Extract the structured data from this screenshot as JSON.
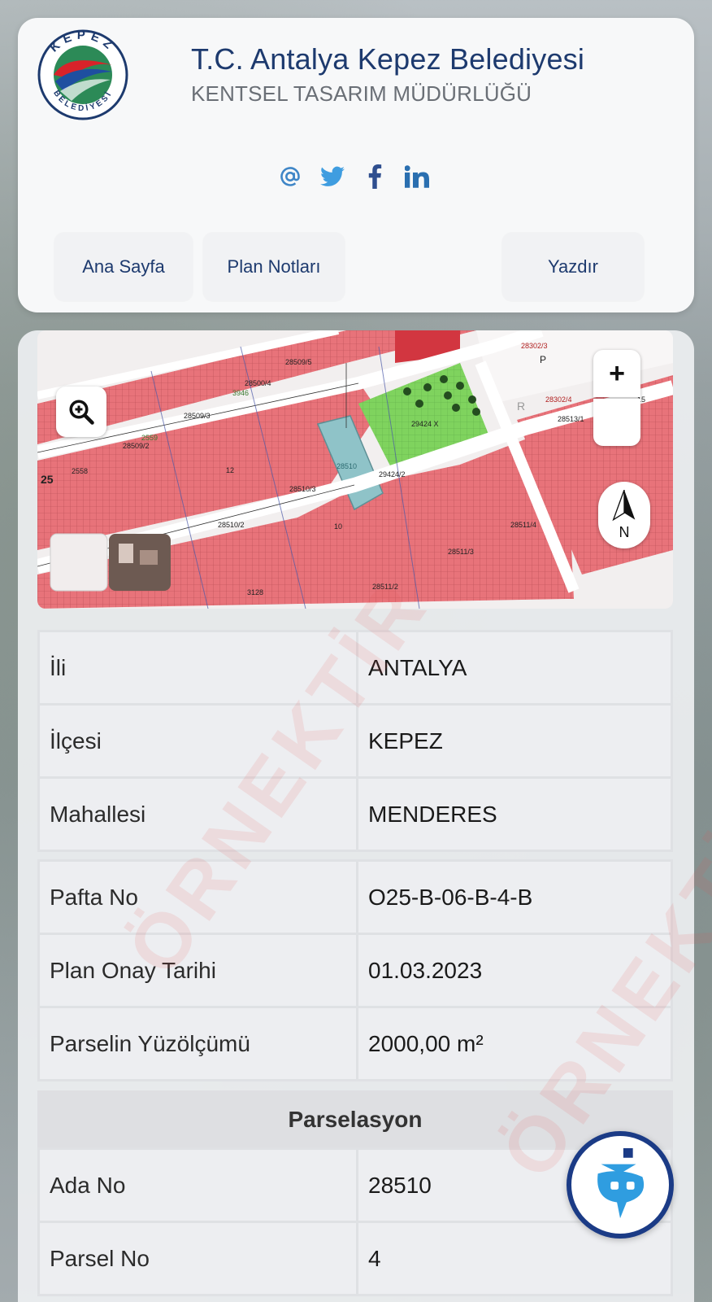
{
  "header": {
    "title": "T.C. Antalya Kepez Belediyesi",
    "subtitle": "KENTSEL TASARIM MÜDÜRLÜĞÜ",
    "logo_top_text": "KEPEZ",
    "logo_bottom_text": "BELEDİYESİ"
  },
  "social": {
    "email_icon": "at-icon",
    "twitter_icon": "twitter-icon",
    "facebook_icon": "facebook-icon",
    "linkedin_icon": "linkedin-icon"
  },
  "nav": {
    "home": "Ana Sayfa",
    "plan_notes": "Plan Notları",
    "print": "Yazdır"
  },
  "map": {
    "zoom_in": "+",
    "north_label": "N",
    "labels": {
      "l1": "28302/3",
      "l2": "28302/4",
      "l3": "28509/5",
      "l4": "28500/4",
      "l5": "28509/3",
      "l6": "28509/2",
      "l7": "28510/3",
      "l8": "28510/2",
      "l9": "28511/4",
      "l10": "28511/3",
      "l11": "28511/2",
      "l12": "29424/2",
      "l13": "29424 X",
      "l14": "28513/1",
      "l15": "28510",
      "l16": "25",
      "l17": "3946",
      "l18": "2559",
      "l19": "2558",
      "l20": "3128",
      "r1": "12",
      "r2": "10",
      "r3": "15",
      "p": "P",
      "rr": "R"
    }
  },
  "location_table": [
    {
      "key": "İli",
      "value": "ANTALYA"
    },
    {
      "key": "İlçesi",
      "value": "KEPEZ"
    },
    {
      "key": "Mahallesi",
      "value": "MENDERES"
    }
  ],
  "plan_table": [
    {
      "key": "Pafta No",
      "value": "O25-B-06-B-4-B"
    },
    {
      "key": "Plan Onay Tarihi",
      "value": "01.03.2023"
    },
    {
      "key": "Parselin Yüzölçümü",
      "value": "2000,00 m²"
    }
  ],
  "parcel": {
    "heading": "Parselasyon",
    "rows": [
      {
        "key": "Ada No",
        "value": "28510"
      },
      {
        "key": "Parsel No",
        "value": "4"
      }
    ]
  },
  "watermark": "ÖRNEKTİR",
  "colors": {
    "brand": "#1d3a6e",
    "zone_red": "#e8737a",
    "park_green": "#7fd35e",
    "selected_parcel": "#8fc3c8"
  }
}
